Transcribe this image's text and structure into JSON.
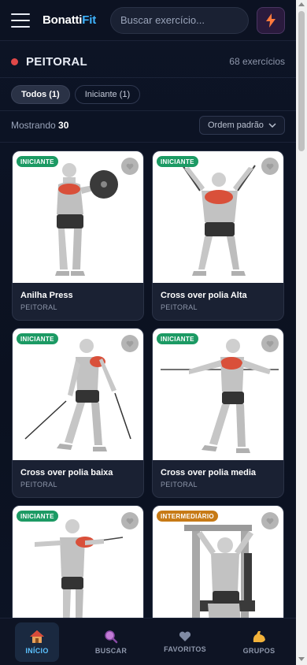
{
  "header": {
    "logo_part1": "Bonatti",
    "logo_part2": "Fit",
    "search_placeholder": "Buscar exercício...",
    "menu_icon": "hamburger-icon",
    "action_icon": "bolt-icon"
  },
  "category": {
    "title": "PEITORAL",
    "count_text": "68 exercícios",
    "accent_color": "#e04848"
  },
  "filters": [
    {
      "label": "Todos (1)",
      "active": true
    },
    {
      "label": "Iniciante (1)",
      "active": false
    }
  ],
  "listing": {
    "showing_label": "Mostrando",
    "showing_value": "30",
    "sort_label": "Ordem padrão"
  },
  "exercises": [
    {
      "name": "Anilha Press",
      "group": "PEITORAL",
      "level": "INICIANTE"
    },
    {
      "name": "Cross over polia Alta",
      "group": "PEITORAL",
      "level": "INICIANTE"
    },
    {
      "name": "Cross over polia baixa",
      "group": "PEITORAL",
      "level": "INICIANTE"
    },
    {
      "name": "Cross over polia media",
      "group": "PEITORAL",
      "level": "INICIANTE"
    },
    {
      "name": "",
      "group": "",
      "level": "INICIANTE"
    },
    {
      "name": "",
      "group": "",
      "level": "INTERMEDIÁRIO"
    }
  ],
  "nav": [
    {
      "label": "INÍCIO",
      "icon": "house-icon",
      "active": true
    },
    {
      "label": "BUSCAR",
      "icon": "magnifier-icon",
      "active": false
    },
    {
      "label": "FAVORITOS",
      "icon": "heart-icon",
      "active": false
    },
    {
      "label": "GRUPOS",
      "icon": "flexed-bicep-icon",
      "active": false
    }
  ],
  "colors": {
    "beginner_badge": "#1c9a64",
    "intermediate_badge": "#c77a16",
    "accent_blue": "#3fb4ff"
  }
}
